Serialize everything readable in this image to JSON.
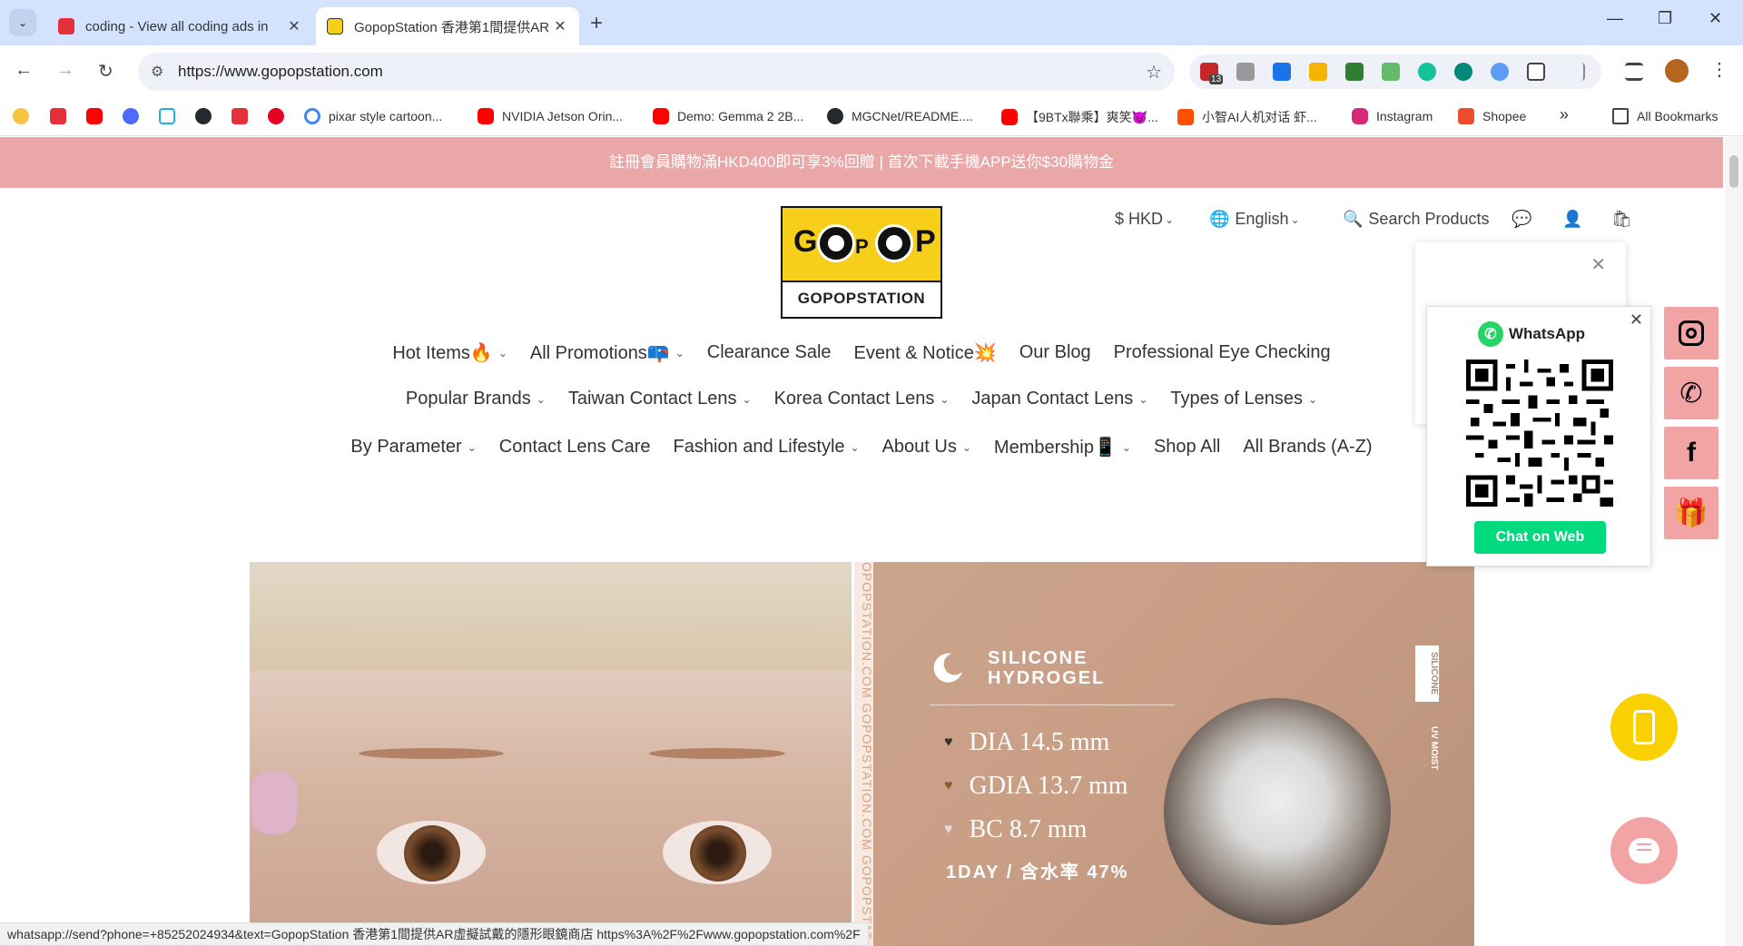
{
  "browser": {
    "tabs": [
      {
        "title": "coding - View all coding ads in",
        "active": false,
        "favicon_color": "#e5303b"
      },
      {
        "title": "GopopStation 香港第1間提供AR",
        "active": true,
        "favicon_color": "#f7ce1a"
      }
    ],
    "new_tab_symbol": "+",
    "window_controls": {
      "minimize": "—",
      "restore": "❐",
      "close": "✕"
    },
    "address": "https://www.gopopstation.com",
    "extension_badge": "13",
    "bookmarks": [
      {
        "label": "",
        "icon": "emoji-icon",
        "color": "#f6c342"
      },
      {
        "label": "",
        "icon": "hkbn-icon",
        "color": "#e5303b"
      },
      {
        "label": "",
        "icon": "youtube-icon",
        "color": "#ff0000"
      },
      {
        "label": "",
        "icon": "deepseek-icon",
        "color": "#4d6bfe"
      },
      {
        "label": "",
        "icon": "bilibili-icon",
        "color": "#23ade5"
      },
      {
        "label": "",
        "icon": "github-icon",
        "color": "#24292e"
      },
      {
        "label": "",
        "icon": "app-icon",
        "color": "#e5303b"
      },
      {
        "label": "",
        "icon": "pinterest-icon",
        "color": "#e60023"
      },
      {
        "label": "pixar style cartoon...",
        "icon": "google-icon",
        "color": "#4285f4"
      },
      {
        "label": "NVIDIA Jetson Orin...",
        "icon": "youtube-icon",
        "color": "#ff0000"
      },
      {
        "label": "Demo: Gemma 2 2B...",
        "icon": "youtube-icon",
        "color": "#ff0000"
      },
      {
        "label": "MGCNet/README....",
        "icon": "github-icon",
        "color": "#24292e"
      },
      {
        "label": "【9BTx聯乘】爽笑😈...",
        "icon": "youtube-icon",
        "color": "#ff0000"
      },
      {
        "label": "小智AI人机对话 虾...",
        "icon": "taobao-icon",
        "color": "#ff5000"
      },
      {
        "label": "Instagram",
        "icon": "instagram-icon",
        "color": "#d62976"
      },
      {
        "label": "Shopee",
        "icon": "shopee-icon",
        "color": "#ee4d2d"
      }
    ],
    "more_bookmarks": "»",
    "all_bookmarks": "All Bookmarks",
    "status_url": "whatsapp://send?phone=+85252024934&text=GopopStation 香港第1間提供AR虛擬試戴的隱形眼鏡商店 https%3A%2F%2Fwww.gopopstation.com%2F"
  },
  "site": {
    "announcement": "註冊會員購物滿HKD400即可享3%回贈 | 首次下載手機APP送你$30購物金",
    "logo_text": "GOPOPSTATION",
    "logo_letters": [
      "G",
      "P",
      "P"
    ],
    "header": {
      "currency": "$ HKD",
      "language": "English",
      "search": "Search Products"
    },
    "menu_rows": [
      [
        {
          "label": "Hot Items🔥",
          "dropdown": true
        },
        {
          "label": "All Promotions📪",
          "dropdown": true
        },
        {
          "label": "Clearance Sale",
          "dropdown": false
        },
        {
          "label": "Event & Notice💥",
          "dropdown": false
        },
        {
          "label": "Our Blog",
          "dropdown": false
        },
        {
          "label": "Professional Eye Checking",
          "dropdown": false
        }
      ],
      [
        {
          "label": "Popular Brands",
          "dropdown": true
        },
        {
          "label": "Taiwan Contact Lens",
          "dropdown": true
        },
        {
          "label": "Korea Contact Lens",
          "dropdown": true
        },
        {
          "label": "Japan Contact Lens",
          "dropdown": true
        },
        {
          "label": "Types of Lenses",
          "dropdown": true
        }
      ],
      [
        {
          "label": "By Parameter",
          "dropdown": true
        },
        {
          "label": "Contact Lens Care",
          "dropdown": false
        },
        {
          "label": "Fashion and Lifestyle",
          "dropdown": true
        },
        {
          "label": "About Us",
          "dropdown": true
        },
        {
          "label": "Membership📱",
          "dropdown": true
        },
        {
          "label": "Shop All",
          "dropdown": false
        },
        {
          "label": "All Brands (A-Z)",
          "dropdown": false
        }
      ]
    ],
    "hero": {
      "watermark": "OPOPSTATION.COM GOPOPSTATION.COM GOPOPSTAT",
      "title_line1": "SILICONE",
      "title_line2": "HYDROGEL",
      "specs": [
        {
          "label": "DIA 14.5 mm",
          "heart_color": "#333333"
        },
        {
          "label": "GDIA 13.7 mm",
          "heart_color": "#8a5a2b"
        },
        {
          "label": "BC 8.7 mm",
          "heart_color": "#dddddd"
        }
      ],
      "footer": "1DAY / 含水率 47%",
      "badge_top": "SILICONE",
      "badge_mid": "UV MOIST"
    },
    "whatsapp_popup": {
      "title": "WhatsApp",
      "button": "Chat on Web",
      "close": "✕"
    },
    "promo_popup_close": "✕",
    "social": [
      "instagram-icon",
      "whatsapp-icon",
      "facebook-icon",
      "gift-icon"
    ]
  }
}
